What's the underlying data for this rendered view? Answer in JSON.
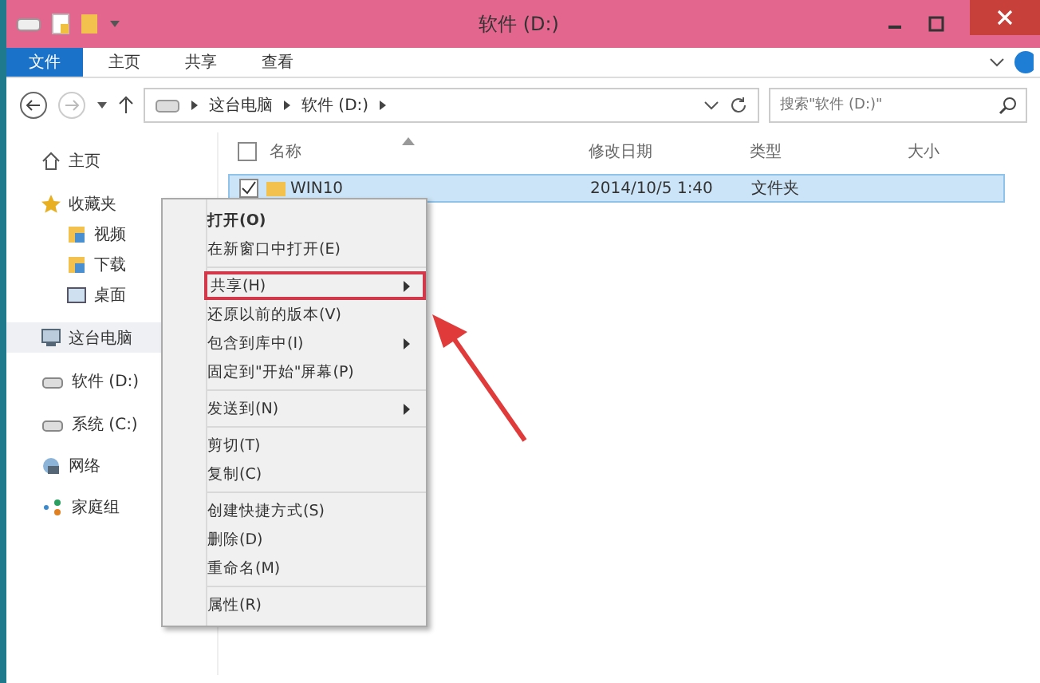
{
  "window": {
    "title": "软件 (D:)"
  },
  "ribbon_tabs": [
    {
      "label": "文件",
      "selected": true
    },
    {
      "label": "主页",
      "selected": false
    },
    {
      "label": "共享",
      "selected": false
    },
    {
      "label": "查看",
      "selected": false
    }
  ],
  "address": {
    "crumbs": [
      "这台电脑",
      "软件 (D:)"
    ]
  },
  "search": {
    "placeholder": "搜索\"软件 (D:)\""
  },
  "sidebar": {
    "items": [
      {
        "label": "主页",
        "selected": false
      },
      {
        "label": "收藏夹",
        "selected": false,
        "children": [
          {
            "label": "视频",
            "selected": false
          },
          {
            "label": "下载",
            "selected": false
          },
          {
            "label": "桌面",
            "selected": false
          }
        ]
      },
      {
        "label": "这台电脑",
        "selected": true
      },
      {
        "label": "软件 (D:)",
        "selected": false
      },
      {
        "label": "系统 (C:)",
        "selected": false
      },
      {
        "label": "网络",
        "selected": false
      },
      {
        "label": "家庭组",
        "selected": false
      }
    ]
  },
  "table": {
    "columns": [
      "名称",
      "修改日期",
      "类型",
      "大小"
    ],
    "select_all_checked": false,
    "rows": [
      {
        "name": "WIN10",
        "date": "2014/10/5 1:40",
        "type": "文件夹",
        "size": "",
        "selected": true
      }
    ]
  },
  "context_menu": {
    "groups": [
      [
        {
          "label": "打开(O)",
          "bold": true,
          "submenu": false,
          "annotated": false
        },
        {
          "label": "在新窗口中打开(E)",
          "bold": false,
          "submenu": false,
          "annotated": false
        }
      ],
      [
        {
          "label": "共享(H)",
          "bold": false,
          "submenu": true,
          "annotated": true
        },
        {
          "label": "还原以前的版本(V)",
          "bold": false,
          "submenu": false,
          "annotated": false
        },
        {
          "label": "包含到库中(I)",
          "bold": false,
          "submenu": true,
          "annotated": false
        },
        {
          "label": "固定到\"开始\"屏幕(P)",
          "bold": false,
          "submenu": false,
          "annotated": false
        }
      ],
      [
        {
          "label": "发送到(N)",
          "bold": false,
          "submenu": true,
          "annotated": false
        }
      ],
      [
        {
          "label": "剪切(T)",
          "bold": false,
          "submenu": false,
          "annotated": false
        },
        {
          "label": "复制(C)",
          "bold": false,
          "submenu": false,
          "annotated": false
        }
      ],
      [
        {
          "label": "创建快捷方式(S)",
          "bold": false,
          "submenu": false,
          "annotated": false
        },
        {
          "label": "删除(D)",
          "bold": false,
          "submenu": false,
          "annotated": false
        },
        {
          "label": "重命名(M)",
          "bold": false,
          "submenu": false,
          "annotated": false
        }
      ],
      [
        {
          "label": "属性(R)",
          "bold": false,
          "submenu": false,
          "annotated": false
        }
      ]
    ]
  }
}
